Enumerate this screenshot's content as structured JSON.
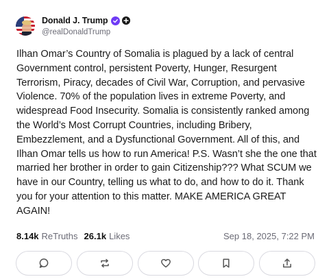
{
  "post": {
    "author": {
      "display_name": "Donald J. Trump",
      "handle": "@realDonaldTrump",
      "avatar": "flag-portrait-avatar",
      "verified_icon": "verified-check-icon",
      "affiliation_icon": "plus-badge-icon"
    },
    "body": "Ilhan Omar’s Country of Somalia is plagued by a lack of central Government control, persistent Poverty, Hunger, Resurgent Terrorism, Piracy, decades of Civil War, Corruption, and pervasive Violence. 70% of the population lives in extreme Poverty, and widespread Food Insecurity. Somalia is consistently ranked among the World’s Most Corrupt Countries, including Bribery, Embezzlement, and a Dysfunctional Government. All of this, and Ilhan Omar tells us how to run America! P.S. Wasn’t she the one that married her brother in order to gain Citizenship??? What SCUM we have in our Country, telling us what to do, and how to do it. Thank you for your attention to this matter. MAKE AMERICA GREAT AGAIN!",
    "stats": {
      "retruths_count": "8.14k",
      "retruths_label": "ReTruths",
      "likes_count": "26.1k",
      "likes_label": "Likes"
    },
    "timestamp": "Sep 18, 2025, 7:22 PM",
    "actions": [
      {
        "name": "reply",
        "icon": "comment-icon"
      },
      {
        "name": "retruth",
        "icon": "repost-icon"
      },
      {
        "name": "like",
        "icon": "heart-icon"
      },
      {
        "name": "bookmark",
        "icon": "bookmark-icon"
      },
      {
        "name": "share",
        "icon": "share-icon"
      }
    ],
    "colors": {
      "verified": "#6f3bf5",
      "muted_text": "#6b6b76",
      "border": "#d9d9e0"
    }
  }
}
